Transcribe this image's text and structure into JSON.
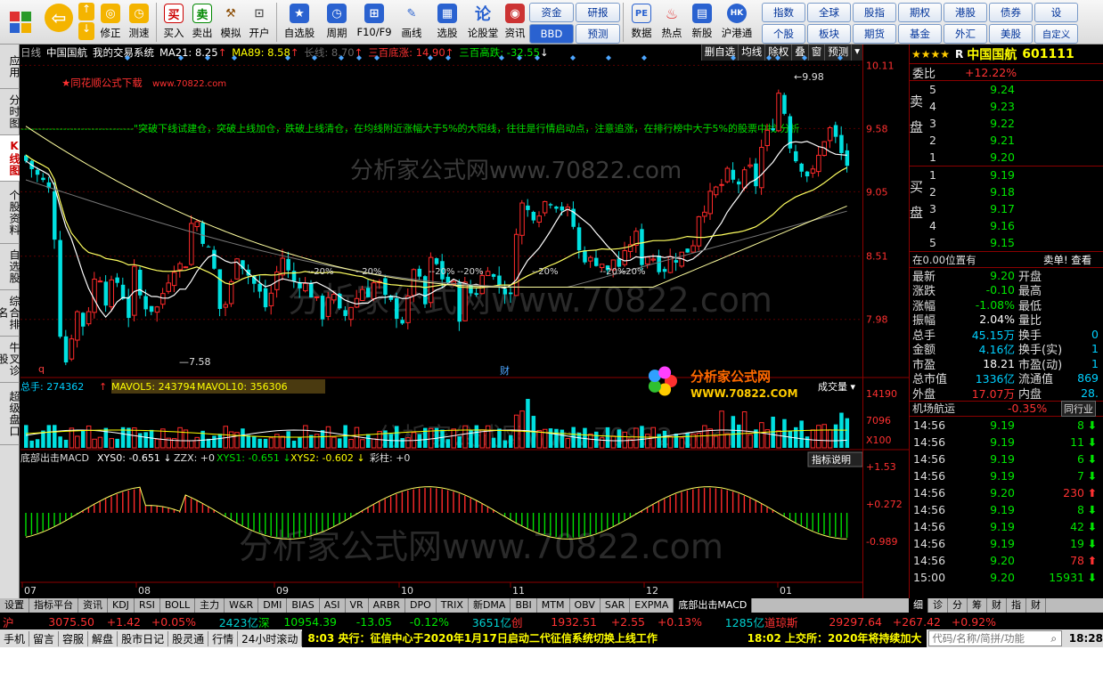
{
  "toolbar": {
    "buttons": [
      "修正",
      "测速",
      "买入",
      "卖出",
      "模拟",
      "开户",
      "自选股",
      "周期",
      "F10/F9",
      "画线",
      "选股",
      "论股堂",
      "资讯",
      "数据",
      "热点",
      "新股",
      "沪港通"
    ],
    "icon_glyphs": [
      "↑",
      "↓",
      "◎",
      "⌂",
      "买",
      "卖",
      "🔨",
      "🔒",
      "★",
      "◷",
      "⊞",
      "✎",
      "▦",
      "论",
      "◉",
      "PE",
      "⚘",
      "▤",
      "HK"
    ],
    "grid_a": [
      "资金",
      "研报",
      "BBD",
      "预测"
    ],
    "grid_b": [
      "指数",
      "全球",
      "股指",
      "期权",
      "港股",
      "债券",
      "个股",
      "板块",
      "期货",
      "基金",
      "外汇",
      "美股"
    ],
    "extra_top": "设",
    "extra_bottom": "自定义"
  },
  "left_tabs": [
    {
      "label": "应用",
      "active": false
    },
    {
      "label": "分时图",
      "active": false
    },
    {
      "label": "K线图",
      "active": true
    },
    {
      "label": "个股资料",
      "active": false
    },
    {
      "label": "自选股",
      "active": false
    },
    {
      "label": "综合排名",
      "active": false
    },
    {
      "label": "牛叉诊股",
      "active": false
    },
    {
      "label": "超级盘口",
      "active": false
    }
  ],
  "chart_header": {
    "period": "日线",
    "name": "中国国航",
    "system": "我的交易系统",
    "ma21": "MA21: 8.25",
    "ma89": "MA89: 8.58",
    "longline": "长线: 8.70",
    "bottom": "三百底涨: 14.90",
    "top": "三百高跌: -32.55",
    "tools": [
      "删自选",
      "均线",
      "除权",
      "叠",
      "窗",
      "预测"
    ]
  },
  "chart_texts": {
    "promo": "★同花顺公式下载",
    "promo_url": "www.70822.com",
    "marquee": "--------------------------------\"突破下线试建仓，突破上线加仓，跌破上线清仓，在均线附近涨幅大于5%的大阳线，往往是行情启动点，注意追涨，在排行榜中大于5%的股票中找 分析",
    "watermark_big": "分析家公式网www.70822.com",
    "watermark_small": "分析家公式网www.70822.com",
    "hi_label": "9.98",
    "lo_label": "7.58",
    "q_label": "q",
    "cai_label": "财",
    "pct_labels": [
      "20%",
      "20%",
      "20%",
      "20%",
      "20%",
      "20%",
      "20%"
    ],
    "logo_line1": "分析家公式网",
    "logo_line2": "WWW.70822.COM"
  },
  "vol_header": {
    "total": "总手: 274362",
    "mavol5": "MAVOL5: 243794",
    "mavol10": "MAVOL10: 356306",
    "right": "成交量"
  },
  "macd_header": {
    "name": "底部出击MACD",
    "xys0": "XYS0: -0.651",
    "zzx": "ZZX: +0",
    "xys1": "XYS1: -0.651",
    "xys2": "XYS2: -0.602",
    "caizhu": "彩柱: +0",
    "help": "指标说明"
  },
  "x_axis": [
    "07",
    "08",
    "09",
    "10",
    "11",
    "12",
    "01"
  ],
  "y_price": [
    "10.11",
    "9.58",
    "9.05",
    "8.51",
    "7.98"
  ],
  "y_vol": [
    "14190",
    "7096",
    "X100"
  ],
  "y_macd": [
    "+1.53",
    "+0.272",
    "-0.989"
  ],
  "bottom_tabs": [
    {
      "label": "设置",
      "active": false
    },
    {
      "label": "指标平台",
      "active": false
    },
    {
      "label": "资讯",
      "active": false
    },
    {
      "label": "KDJ",
      "active": false
    },
    {
      "label": "RSI",
      "active": false
    },
    {
      "label": "BOLL",
      "active": false
    },
    {
      "label": "主力",
      "active": false
    },
    {
      "label": "W&R",
      "active": false
    },
    {
      "label": "DMI",
      "active": false
    },
    {
      "label": "BIAS",
      "active": false
    },
    {
      "label": "ASI",
      "active": false
    },
    {
      "label": "VR",
      "active": false
    },
    {
      "label": "ARBR",
      "active": false
    },
    {
      "label": "DPO",
      "active": false
    },
    {
      "label": "TRIX",
      "active": false
    },
    {
      "label": "新DMA",
      "active": false
    },
    {
      "label": "BBI",
      "active": false
    },
    {
      "label": "MTM",
      "active": false
    },
    {
      "label": "OBV",
      "active": false
    },
    {
      "label": "SAR",
      "active": false
    },
    {
      "label": "EXPMA",
      "active": false
    },
    {
      "label": "底部出击MACD",
      "active": true
    }
  ],
  "right_panel": {
    "stars": "★★★★",
    "r": "R",
    "name": "中国国航",
    "code": "601111",
    "weibi_label": "委比",
    "weibi": "+12.22%",
    "sell_label": "卖盘",
    "buy_label": "买盘",
    "sell": [
      {
        "n": "5",
        "p": "9.24"
      },
      {
        "n": "4",
        "p": "9.23"
      },
      {
        "n": "3",
        "p": "9.22"
      },
      {
        "n": "2",
        "p": "9.21"
      },
      {
        "n": "1",
        "p": "9.20"
      }
    ],
    "buy": [
      {
        "n": "1",
        "p": "9.19"
      },
      {
        "n": "2",
        "p": "9.18"
      },
      {
        "n": "3",
        "p": "9.17"
      },
      {
        "n": "4",
        "p": "9.16"
      },
      {
        "n": "5",
        "p": "9.15"
      }
    ],
    "position_text": "在0.00位置有",
    "sell_order_text": "卖单! 查看",
    "stats": [
      {
        "l": "最新",
        "v": "9.20",
        "c": "green",
        "l2": "开盘"
      },
      {
        "l": "涨跌",
        "v": "-0.10",
        "c": "green",
        "l2": "最高"
      },
      {
        "l": "涨幅",
        "v": "-1.08%",
        "c": "green",
        "l2": "最低"
      },
      {
        "l": "振幅",
        "v": "2.04%",
        "c": "white",
        "l2": "量比"
      },
      {
        "l": "总手",
        "v": "45.15万",
        "c": "cyan",
        "l2": "换手",
        "v2": "0"
      },
      {
        "l": "金额",
        "v": "4.16亿",
        "c": "cyan",
        "l2": "换手(实)",
        "v2": "1"
      },
      {
        "l": "市盈",
        "v": "18.21",
        "c": "white",
        "l2": "市盈(动)",
        "v2": "1"
      },
      {
        "l": "总市值",
        "v": "1336亿",
        "c": "cyan",
        "l2": "流通值",
        "v2": "869"
      },
      {
        "l": "外盘",
        "v": "17.07万",
        "c": "red",
        "l2": "内盘",
        "v2": "28."
      }
    ],
    "sector_name": "机场航运",
    "sector_pct": "-0.35%",
    "sector_btn": "同行业",
    "ticks": [
      {
        "t": "14:56",
        "p": "9.19",
        "v": "8",
        "d": "down"
      },
      {
        "t": "14:56",
        "p": "9.19",
        "v": "11",
        "d": "down"
      },
      {
        "t": "14:56",
        "p": "9.19",
        "v": "6",
        "d": "down"
      },
      {
        "t": "14:56",
        "p": "9.19",
        "v": "7",
        "d": "down"
      },
      {
        "t": "14:56",
        "p": "9.20",
        "v": "230",
        "d": "up"
      },
      {
        "t": "14:56",
        "p": "9.19",
        "v": "8",
        "d": "down"
      },
      {
        "t": "14:56",
        "p": "9.19",
        "v": "42",
        "d": "down"
      },
      {
        "t": "14:56",
        "p": "9.19",
        "v": "19",
        "d": "down"
      },
      {
        "t": "14:56",
        "p": "9.20",
        "v": "78",
        "d": "up"
      },
      {
        "t": "15:00",
        "p": "9.20",
        "v": "15931",
        "d": "down"
      }
    ],
    "tabs": [
      "细",
      "诊",
      "分",
      "筹",
      "财",
      "指",
      "财"
    ]
  },
  "index_bar": {
    "sh_label": "沪",
    "sh": "3075.50",
    "sh_chg": "+1.42",
    "sh_pct": "+0.05%",
    "sh_amt": "2423亿",
    "sz_label": "深",
    "sz": "10954.39",
    "sz_chg": "-13.05",
    "sz_pct": "-0.12%",
    "sz_amt": "3651亿",
    "cy_label": "创",
    "cy": "1932.51",
    "cy_chg": "+2.55",
    "cy_pct": "+0.13%",
    "cy_amt": "1285亿",
    "dj_label": "道琼斯",
    "dj": "29297.64",
    "dj_chg": "+267.42",
    "dj_pct": "+0.92%"
  },
  "news_bar": {
    "items": [
      "手机",
      "留言",
      "容服",
      "解盘",
      "股市日记",
      "股灵通",
      "行情",
      "24小时滚动"
    ],
    "news1_time": "8:03",
    "news1": "央行：征信中心于2020年1月17日启动二代征信系统切换上线工作",
    "news2_time": "18:02",
    "news2": "上交所：2020年将持续加大",
    "search_placeholder": "代码/名称/简拼/功能",
    "clock": "18:28"
  }
}
